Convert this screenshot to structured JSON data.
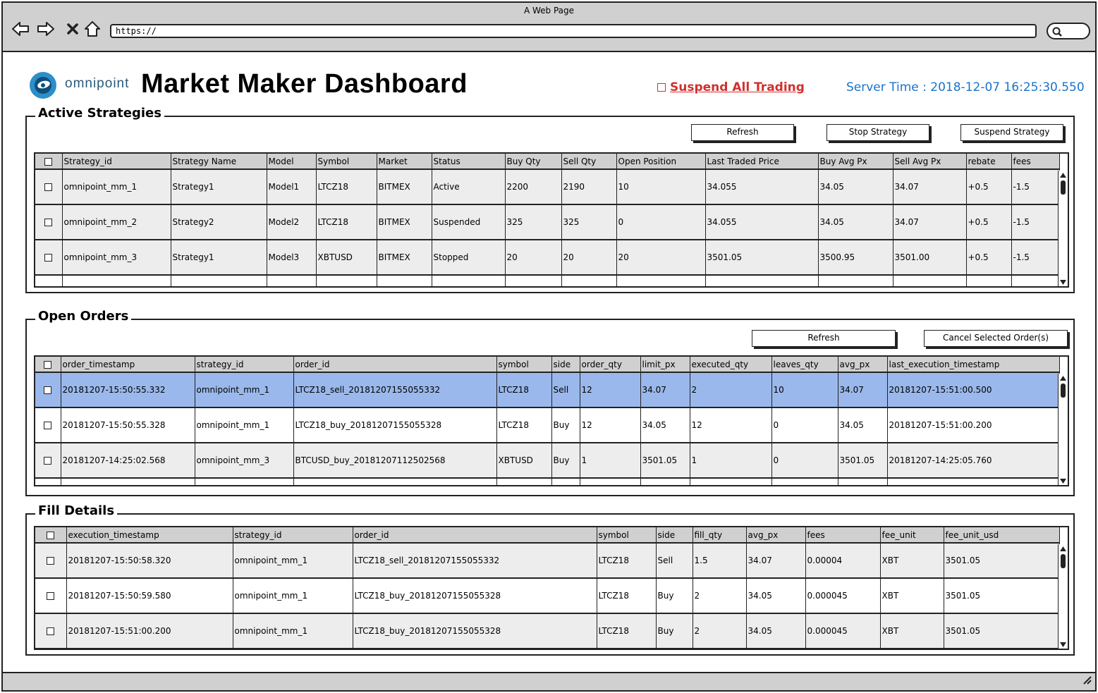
{
  "browser": {
    "title": "A Web Page",
    "url": "https://"
  },
  "header": {
    "logo_text": "omnipoint",
    "page_title": "Market Maker Dashboard",
    "suspend_all_label": "Suspend All Trading",
    "server_time_label": "Server Time : 2018-12-07 16:25:30.550"
  },
  "active_strategies": {
    "title": "Active Strategies",
    "buttons": {
      "refresh": "Refresh",
      "stop": "Stop Strategy",
      "suspend": "Suspend Strategy"
    },
    "columns": [
      "Strategy_id",
      "Strategy Name",
      "Model",
      "Symbol",
      "Market",
      "Status",
      "Buy Qty",
      "Sell Qty",
      "Open Position",
      "Last Traded Price",
      "Buy Avg Px",
      "Sell Avg Px",
      "rebate",
      "fees"
    ],
    "rows": [
      [
        "omnipoint_mm_1",
        "Strategy1",
        "Model1",
        "LTCZ18",
        "BITMEX",
        "Active",
        "2200",
        "2190",
        "10",
        "34.055",
        "34.05",
        "34.07",
        "+0.5",
        "-1.5"
      ],
      [
        "omnipoint_mm_2",
        "Strategy2",
        "Model2",
        "LTCZ18",
        "BITMEX",
        "Suspended",
        "325",
        "325",
        "0",
        "34.055",
        "34.05",
        "34.07",
        "+0.5",
        "-1.5"
      ],
      [
        "omnipoint_mm_3",
        "Strategy1",
        "Model3",
        "XBTUSD",
        "BITMEX",
        "Stopped",
        "20",
        "20",
        "20",
        "3501.05",
        "3500.95",
        "3501.00",
        "+0.5",
        "-1.5"
      ]
    ]
  },
  "open_orders": {
    "title": "Open Orders",
    "buttons": {
      "refresh": "Refresh",
      "cancel": "Cancel Selected Order(s)"
    },
    "columns": [
      "order_timestamp",
      "strategy_id",
      "order_id",
      "symbol",
      "side",
      "order_qty",
      "limit_px",
      "executed_qty",
      "leaves_qty",
      "avg_px",
      "last_execution_timestamp"
    ],
    "rows": [
      [
        "20181207-15:50:55.332",
        "omnipoint_mm_1",
        "LTCZ18_sell_20181207155055332",
        "LTCZ18",
        "Sell",
        "12",
        "34.07",
        "2",
        "10",
        "34.07",
        "20181207-15:51:00.500"
      ],
      [
        "20181207-15:50:55.328",
        "omnipoint_mm_1",
        "LTCZ18_buy_20181207155055328",
        "LTCZ18",
        "Buy",
        "12",
        "34.05",
        "12",
        "0",
        "34.05",
        "20181207-15:51:00.200"
      ],
      [
        "20181207-14:25:02.568",
        "omnipoint_mm_3",
        "BTCUSD_buy_20181207112502568",
        "XBTUSD",
        "Buy",
        "1",
        "3501.05",
        "1",
        "0",
        "3501.05",
        "20181207-14:25:05.760"
      ]
    ],
    "selected_row": 0
  },
  "fill_details": {
    "title": "Fill Details",
    "columns": [
      "execution_timestamp",
      "strategy_id",
      "order_id",
      "symbol",
      "side",
      "fill_qty",
      "avg_px",
      "fees",
      "fee_unit",
      "fee_unit_usd"
    ],
    "rows": [
      [
        "20181207-15:50:58.320",
        "omnipoint_mm_1",
        "LTCZ18_sell_20181207155055332",
        "LTCZ18",
        "Sell",
        "1.5",
        "34.07",
        "0.00004",
        "XBT",
        "3501.05"
      ],
      [
        "20181207-15:50:59.580",
        "omnipoint_mm_1",
        "LTCZ18_buy_20181207155055328",
        "LTCZ18",
        "Buy",
        "2",
        "34.05",
        "0.000045",
        "XBT",
        "3501.05"
      ],
      [
        "20181207-15:51:00.200",
        "omnipoint_mm_1",
        "LTCZ18_buy_20181207155055328",
        "LTCZ18",
        "Buy",
        "2",
        "34.05",
        "0.000045",
        "XBT",
        "3501.05"
      ]
    ]
  },
  "colors": {
    "accent_blue": "#1a73c9",
    "danger_red": "#d0312d",
    "selected_row": "#9ab8eb",
    "chrome_gray": "#d0d0d0"
  },
  "icons": [
    "back-arrow-icon",
    "forward-arrow-icon",
    "close-x-icon",
    "home-icon",
    "search-icon",
    "resize-grip-icon",
    "scroll-up-icon",
    "scroll-down-icon",
    "omnipoint-logo-icon"
  ]
}
